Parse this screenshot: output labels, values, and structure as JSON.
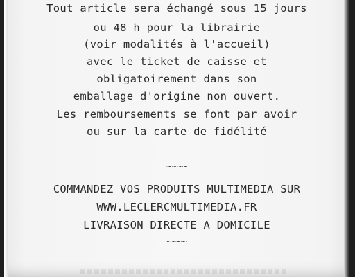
{
  "receipt": {
    "lines": [
      "Tout article sera échangé sous 15 jours",
      "ou 48 h pour la librairie",
      "(voir modalités à l'accueil)",
      "avec le ticket de caisse et",
      "obligatoirement dans son",
      "emballage d'origine non ouvert.",
      "Les remboursements se font par avoir",
      "ou sur la carte de fidélité"
    ],
    "separator_1": "~~~~",
    "promo": [
      "COMMANDEZ VOS PRODUITS MULTIMEDIA SUR",
      "WWW.LECLERCMULTIMEDIA.FR",
      "LIVRAISON DIRECTE A DOMICILE"
    ],
    "separator_2": "~~~~"
  }
}
